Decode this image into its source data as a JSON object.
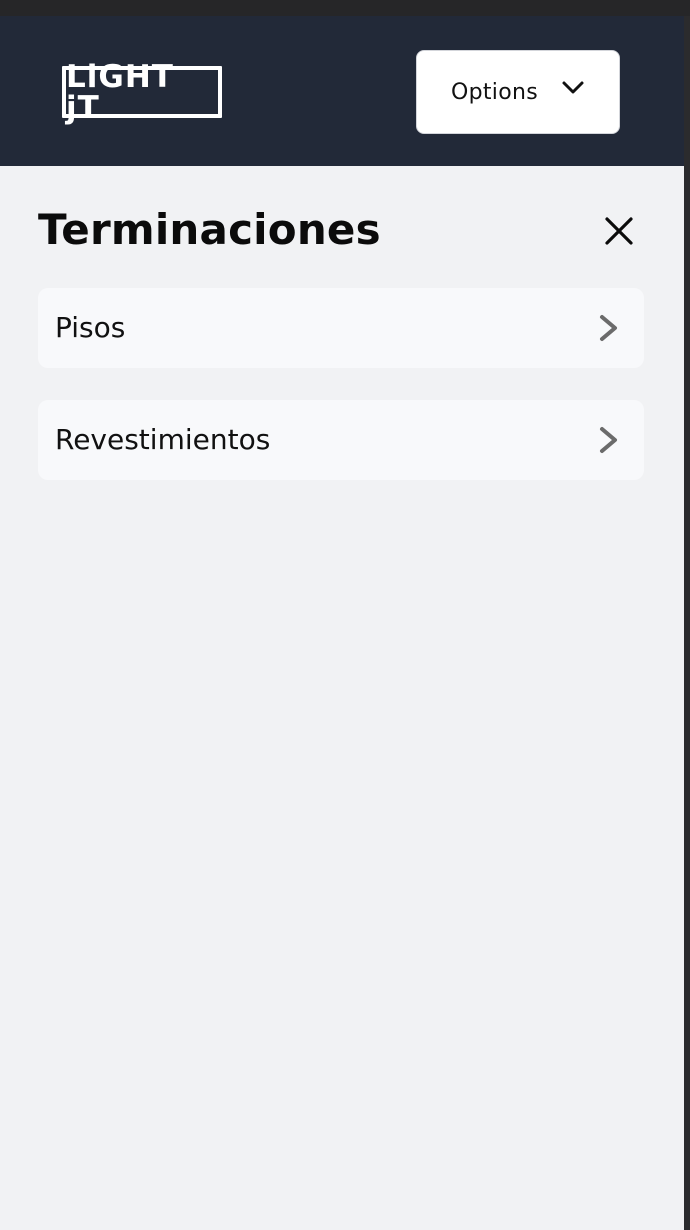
{
  "header": {
    "logo_text": "LiGHT jT",
    "options_label": "Options"
  },
  "panel": {
    "title": "Terminaciones",
    "items": [
      {
        "label": "Pisos"
      },
      {
        "label": "Revestimientos"
      }
    ]
  },
  "icons": {
    "options": "chevron-down-icon",
    "close": "close-icon",
    "item_arrow": "chevron-right-icon"
  },
  "colors": {
    "header_bg": "#222938",
    "panel_bg": "#f1f2f4",
    "item_bg": "#f8f9fb",
    "chevron": "#6b6b6b"
  }
}
